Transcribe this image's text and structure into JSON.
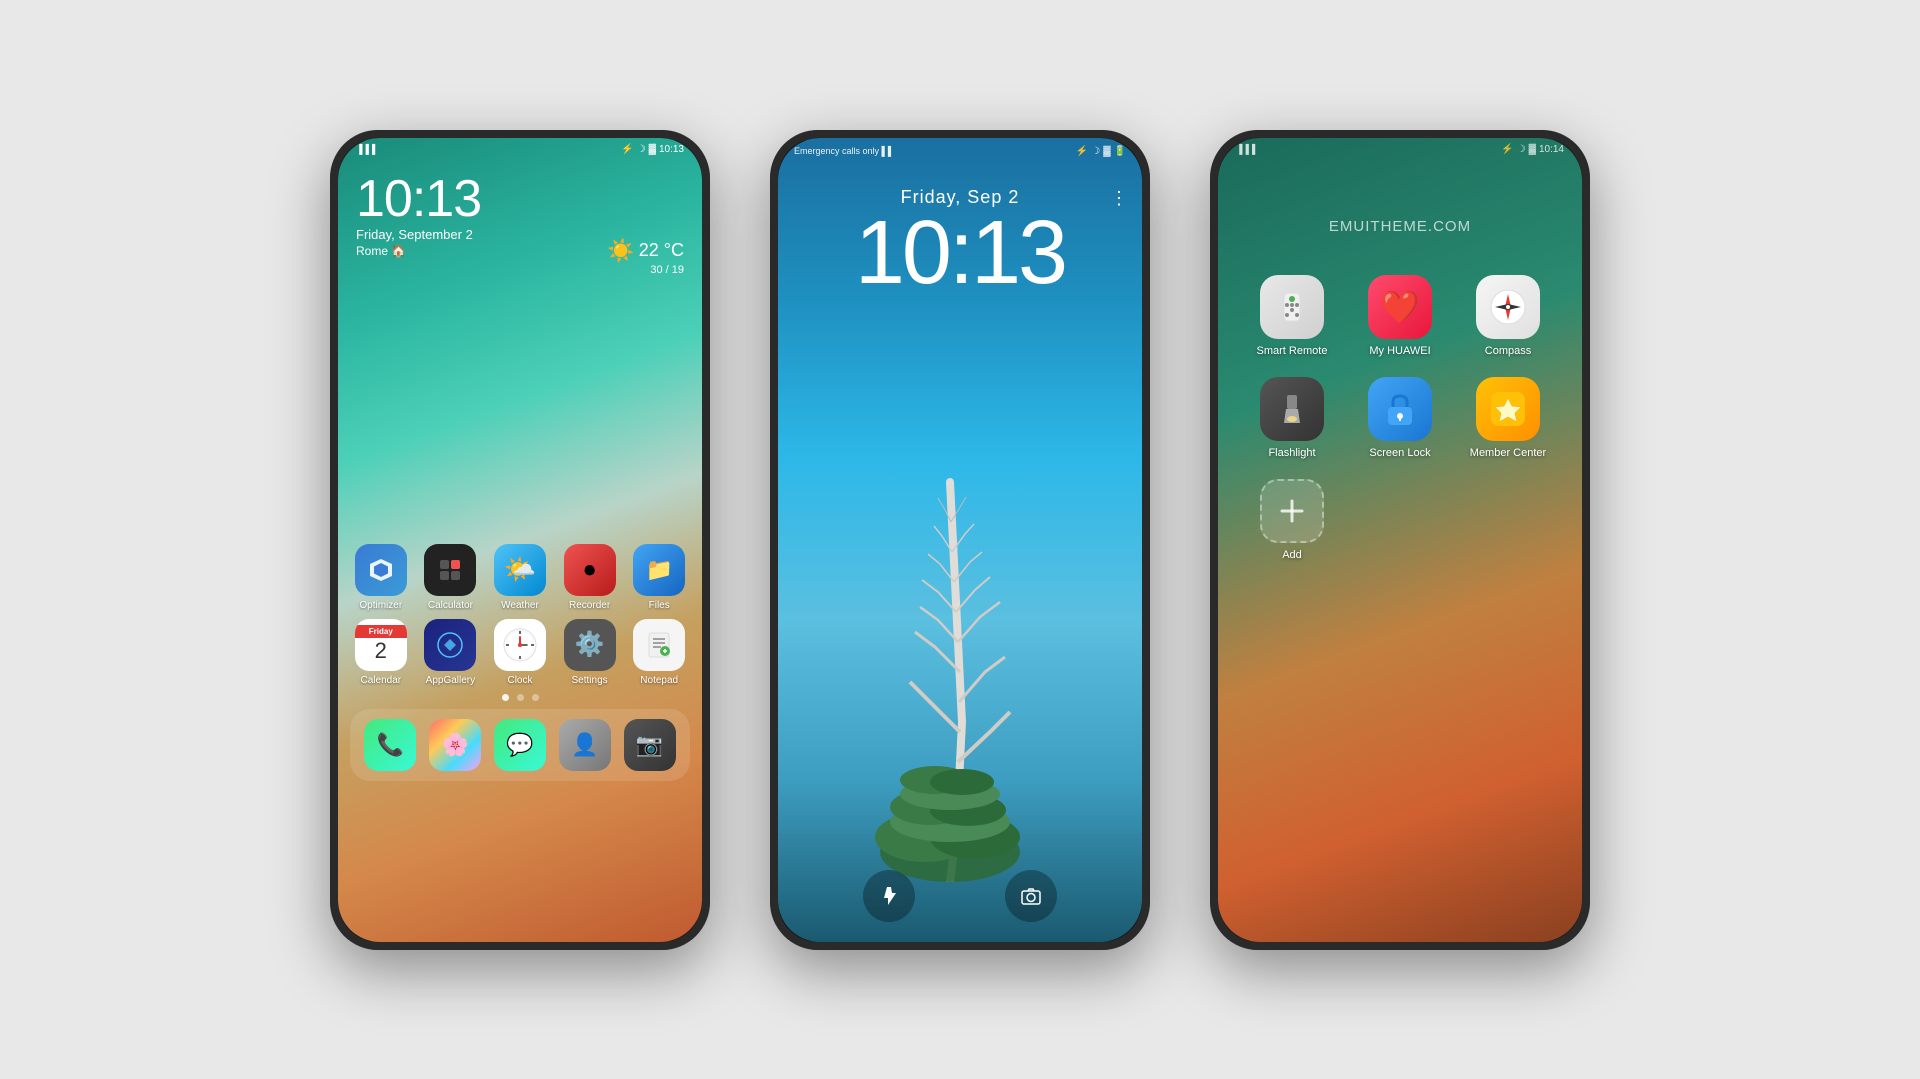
{
  "phone1": {
    "status": {
      "left": "▌▌▌",
      "right": "🔵 ☾ ▣ 🔋 10:13"
    },
    "clock": {
      "time": "10:13",
      "date": "Friday, September 2",
      "location": "Rome 🏠"
    },
    "weather": {
      "icon": "☀️",
      "temp": "22 °C",
      "range": "30 / 19"
    },
    "apps_row1": [
      {
        "label": "Optimizer",
        "icon": "🛡️",
        "class": "icon-optimizer"
      },
      {
        "label": "Calculator",
        "icon": "➕",
        "class": "icon-calculator"
      },
      {
        "label": "Weather",
        "icon": "🌤️",
        "class": "icon-weather"
      },
      {
        "label": "Recorder",
        "icon": "⏺️",
        "class": "icon-recorder"
      },
      {
        "label": "Files",
        "icon": "📁",
        "class": "icon-files"
      }
    ],
    "apps_row2": [
      {
        "label": "Calendar",
        "icon": "cal",
        "class": "icon-calendar"
      },
      {
        "label": "AppGallery",
        "icon": "▶",
        "class": "icon-appgallery"
      },
      {
        "label": "Clock",
        "icon": "clock",
        "class": "icon-clock"
      },
      {
        "label": "Settings",
        "icon": "⚙️",
        "class": "icon-settings"
      },
      {
        "label": "Notepad",
        "icon": "📝",
        "class": "icon-notepad"
      }
    ],
    "dock": [
      {
        "label": "Phone",
        "icon": "📞",
        "class": "icon-phone"
      },
      {
        "label": "Photos",
        "icon": "🖼️",
        "class": "icon-photos"
      },
      {
        "label": "Messages",
        "icon": "💬",
        "class": "icon-messages"
      },
      {
        "label": "Contacts",
        "icon": "👤",
        "class": "icon-contacts"
      },
      {
        "label": "Camera",
        "icon": "📷",
        "class": "icon-camera"
      }
    ]
  },
  "phone2": {
    "status": {
      "left": "Emergency calls only ▌▌",
      "right": "🔵 ☾ ▣ 🔋"
    },
    "time": "10:13",
    "date": "Friday,  Sep 2",
    "time_display": "10:13"
  },
  "phone3": {
    "status": {
      "left": "▌▌▌",
      "right": "🔵 ☾ ▣ 🔋 10:14"
    },
    "title": "EMUITHEME.COM",
    "apps": [
      {
        "label": "Smart Remote",
        "icon": "📡",
        "class": "icon-smart-remote"
      },
      {
        "label": "My HUAWEI",
        "icon": "❤️",
        "class": "icon-my-huawei"
      },
      {
        "label": "Compass",
        "icon": "🧭",
        "class": "icon-compass"
      },
      {
        "label": "Flashlight",
        "icon": "🔦",
        "class": "icon-flashlight"
      },
      {
        "label": "Screen Lock",
        "icon": "🔒",
        "class": "icon-screen-lock"
      },
      {
        "label": "Member Center",
        "icon": "👑",
        "class": "icon-member-center"
      },
      {
        "label": "Add",
        "icon": "➕",
        "class": "icon-add"
      }
    ]
  }
}
